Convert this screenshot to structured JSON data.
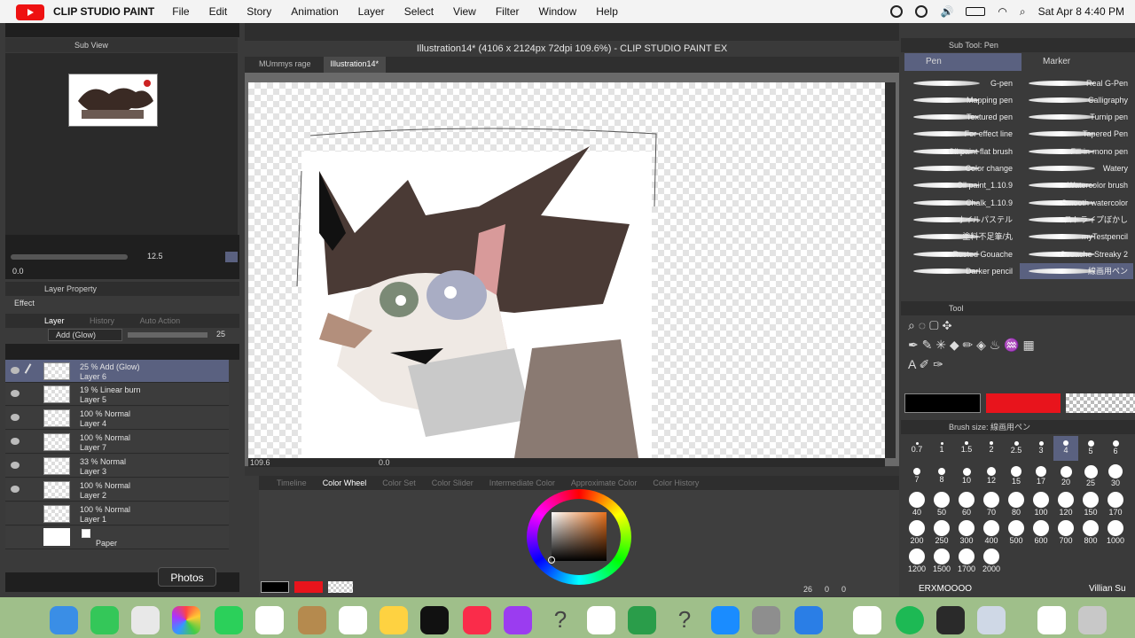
{
  "menubar": {
    "app": "CLIP STUDIO PAINT",
    "items": [
      "File",
      "Edit",
      "Story",
      "Animation",
      "Layer",
      "Select",
      "View",
      "Filter",
      "Window",
      "Help"
    ],
    "datetime": "Sat Apr 8  4:40 PM"
  },
  "subview": {
    "title": "Sub View"
  },
  "navigator": {
    "zoom": "12.5",
    "angle": "0.0"
  },
  "layer_property": {
    "title": "Layer Property",
    "effect": "Effect"
  },
  "layer_panel": {
    "tabs": [
      "Layer",
      "History",
      "Auto Action"
    ],
    "blend_mode": "Add (Glow)",
    "opacity": "25",
    "layers": [
      {
        "line1": "25 % Add (Glow)",
        "line2": "Layer 6",
        "selected": true
      },
      {
        "line1": "19 % Linear burn",
        "line2": "Layer 5"
      },
      {
        "line1": "100 % Normal",
        "line2": "Layer 4"
      },
      {
        "line1": "100 % Normal",
        "line2": "Layer 7"
      },
      {
        "line1": "33 % Normal",
        "line2": "Layer 3"
      },
      {
        "line1": "100 % Normal",
        "line2": "Layer 2"
      },
      {
        "line1": "100 % Normal",
        "line2": "Layer 1"
      },
      {
        "line1": "",
        "line2": "Paper"
      }
    ]
  },
  "tooltip": "Photos",
  "document": {
    "title": "Illustration14* (4106 x 2124px 72dpi 109.6%)  - CLIP STUDIO PAINT EX",
    "tabs": [
      "MUmmys rage",
      "Illustration14*"
    ],
    "zoom": "109.6",
    "angle": "0.0"
  },
  "color_tabs": [
    "Timeline",
    "Color Wheel",
    "Color Set",
    "Color Slider",
    "Intermediate Color",
    "Approximate Color",
    "Color History"
  ],
  "status": {
    "a": "26",
    "b": "0",
    "c": "0"
  },
  "subtool": {
    "title": "Sub Tool: Pen",
    "groups": [
      "Pen",
      "Marker"
    ],
    "brushes_left": [
      "G-pen",
      "Mapping pen",
      "Textured pen",
      "For effect line",
      "Oil paint flat brush",
      "Color change",
      "Oil paint_1.10.9",
      "Chalk_1.10.9",
      "オイルパステル",
      "塗料不足筆/丸",
      "Rusted Gouache",
      "Darker pencil"
    ],
    "brushes_right": [
      "Real G-Pen",
      "Calligraphy",
      "Turnip pen",
      "Tapered Pen",
      "Fill-in-mono pen",
      "Watery",
      "Watercolor brush",
      "Smooth watercolor",
      "ストライプぼかし",
      "myTestpencil",
      "Gouache Streaky 2",
      "線画用ペン"
    ]
  },
  "tool": {
    "title": "Tool"
  },
  "colors": {
    "main": "#000000",
    "sub": "#e8141c",
    "accent": "#5a6180"
  },
  "brush_size": {
    "title": "Brush size: 線画用ペン",
    "sizes": [
      "0.7",
      "1",
      "1.5",
      "2",
      "2.5",
      "3",
      "4",
      "5",
      "6",
      "7",
      "8",
      "10",
      "12",
      "15",
      "17",
      "20",
      "25",
      "30",
      "40",
      "50",
      "60",
      "70",
      "80",
      "100",
      "120",
      "150",
      "170",
      "200",
      "250",
      "300",
      "400",
      "500",
      "600",
      "700",
      "800",
      "1000",
      "1200",
      "1500",
      "1700",
      "2000"
    ],
    "selected": "4"
  },
  "video_overlay": {
    "left": "ERXMOOOO",
    "right": "Villian Su"
  }
}
